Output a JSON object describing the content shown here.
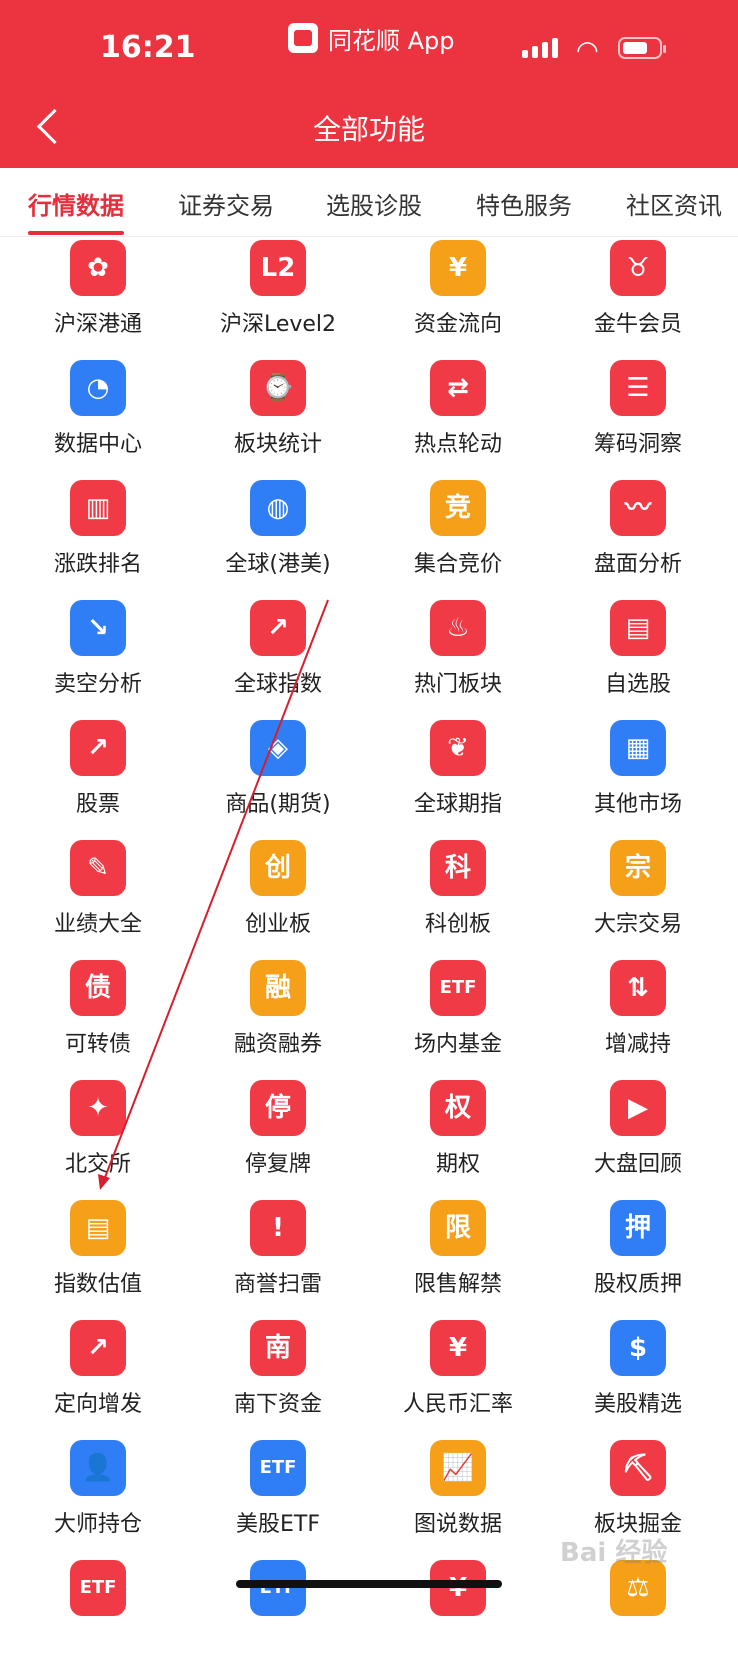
{
  "status": {
    "time": "16:21",
    "app_name": "同花顺 App"
  },
  "header": {
    "title": "全部功能"
  },
  "tabs": [
    "行情数据",
    "证券交易",
    "选股诊股",
    "特色服务",
    "社区资讯"
  ],
  "grid": [
    {
      "label": "沪深港通",
      "icon": "bauhinia-icon",
      "glyph": "✿",
      "color": "red"
    },
    {
      "label": "沪深Level2",
      "icon": "level2-icon",
      "glyph": "L2",
      "color": "red"
    },
    {
      "label": "资金流向",
      "icon": "yuan-coin-icon",
      "glyph": "¥",
      "color": "orange"
    },
    {
      "label": "金牛会员",
      "icon": "bull-icon",
      "glyph": "♉",
      "color": "red"
    },
    {
      "label": "数据中心",
      "icon": "pie-chart-icon",
      "glyph": "◔",
      "color": "blue"
    },
    {
      "label": "板块统计",
      "icon": "stat-doc-icon",
      "glyph": "⌚",
      "color": "red"
    },
    {
      "label": "热点轮动",
      "icon": "rotate-icon",
      "glyph": "⇄",
      "color": "red"
    },
    {
      "label": "筹码洞察",
      "icon": "document-icon",
      "glyph": "☰",
      "color": "red"
    },
    {
      "label": "涨跌排名",
      "icon": "bar-chart-icon",
      "glyph": "▥",
      "color": "red"
    },
    {
      "label": "全球(港美)",
      "icon": "planet-icon",
      "glyph": "◍",
      "color": "blue"
    },
    {
      "label": "集合竞价",
      "icon": "jing-char-icon",
      "glyph": "竞",
      "color": "orange"
    },
    {
      "label": "盘面分析",
      "icon": "pulse-icon",
      "glyph": "〰",
      "color": "red"
    },
    {
      "label": "卖空分析",
      "icon": "trend-down-icon",
      "glyph": "↘",
      "color": "blue"
    },
    {
      "label": "全球指数",
      "icon": "trend-circle-icon",
      "glyph": "↗",
      "color": "red"
    },
    {
      "label": "热门板块",
      "icon": "flame-icon",
      "glyph": "♨",
      "color": "red"
    },
    {
      "label": "自选股",
      "icon": "folder-icon",
      "glyph": "▤",
      "color": "red"
    },
    {
      "label": "股票",
      "icon": "trend-up-icon",
      "glyph": "↗",
      "color": "red"
    },
    {
      "label": "商品(期货)",
      "icon": "commodity-icon",
      "glyph": "◈",
      "color": "blue"
    },
    {
      "label": "全球期指",
      "icon": "leaf-icon",
      "glyph": "❦",
      "color": "red"
    },
    {
      "label": "其他市场",
      "icon": "grid-layout-icon",
      "glyph": "▦",
      "color": "blue"
    },
    {
      "label": "业绩大全",
      "icon": "report-icon",
      "glyph": "✎",
      "color": "red"
    },
    {
      "label": "创业板",
      "icon": "chuang-char-icon",
      "glyph": "创",
      "color": "orange"
    },
    {
      "label": "科创板",
      "icon": "ke-char-icon",
      "glyph": "科",
      "color": "red"
    },
    {
      "label": "大宗交易",
      "icon": "zong-char-icon",
      "glyph": "宗",
      "color": "orange"
    },
    {
      "label": "可转债",
      "icon": "zhai-char-icon",
      "glyph": "债",
      "color": "red"
    },
    {
      "label": "融资融券",
      "icon": "rong-char-icon",
      "glyph": "融",
      "color": "orange"
    },
    {
      "label": "场内基金",
      "icon": "etf-icon",
      "glyph": "ETF",
      "color": "red"
    },
    {
      "label": "增减持",
      "icon": "up-down-arrows-icon",
      "glyph": "⇅",
      "color": "red"
    },
    {
      "label": "北交所",
      "icon": "compass-icon",
      "glyph": "✦",
      "color": "red"
    },
    {
      "label": "停复牌",
      "icon": "ting-char-icon",
      "glyph": "停",
      "color": "red"
    },
    {
      "label": "期权",
      "icon": "quan-char-icon",
      "glyph": "权",
      "color": "red"
    },
    {
      "label": "大盘回顾",
      "icon": "replay-icon",
      "glyph": "▶",
      "color": "red"
    },
    {
      "label": "指数估值",
      "icon": "monitor-chart-icon",
      "glyph": "▤",
      "color": "orange"
    },
    {
      "label": "商誉扫雷",
      "icon": "shield-alert-icon",
      "glyph": "!",
      "color": "red"
    },
    {
      "label": "限售解禁",
      "icon": "xian-char-icon",
      "glyph": "限",
      "color": "orange"
    },
    {
      "label": "股权质押",
      "icon": "ya-char-icon",
      "glyph": "押",
      "color": "blue"
    },
    {
      "label": "定向增发",
      "icon": "expand-arrow-icon",
      "glyph": "↗",
      "color": "red"
    },
    {
      "label": "南下资金",
      "icon": "nan-char-icon",
      "glyph": "南",
      "color": "red"
    },
    {
      "label": "人民币汇率",
      "icon": "currency-exchange-icon",
      "glyph": "¥",
      "color": "red"
    },
    {
      "label": "美股精选",
      "icon": "dollar-hex-icon",
      "glyph": "$",
      "color": "blue"
    },
    {
      "label": "大师持仓",
      "icon": "person-icon",
      "glyph": "👤",
      "color": "blue"
    },
    {
      "label": "美股ETF",
      "icon": "etf-us-icon",
      "glyph": "ETF",
      "color": "blue"
    },
    {
      "label": "图说数据",
      "icon": "chart-picture-icon",
      "glyph": "📈",
      "color": "orange"
    },
    {
      "label": "板块掘金",
      "icon": "shovel-icon",
      "glyph": "⛏",
      "color": "red"
    },
    {
      "label": "",
      "icon": "etf-icon",
      "glyph": "ETF",
      "color": "red"
    },
    {
      "label": "",
      "icon": "etf-icon",
      "glyph": "ETF",
      "color": "blue"
    },
    {
      "label": "",
      "icon": "yuan-icon",
      "glyph": "¥",
      "color": "red"
    },
    {
      "label": "",
      "icon": "scale-icon",
      "glyph": "⚖",
      "color": "orange"
    }
  ],
  "watermark": "Bai 经验",
  "colors": {
    "header": "#ec3340",
    "active_tab": "#e62e3c",
    "red": "#f03a46",
    "orange": "#f6a019",
    "blue": "#2f7ef6"
  }
}
